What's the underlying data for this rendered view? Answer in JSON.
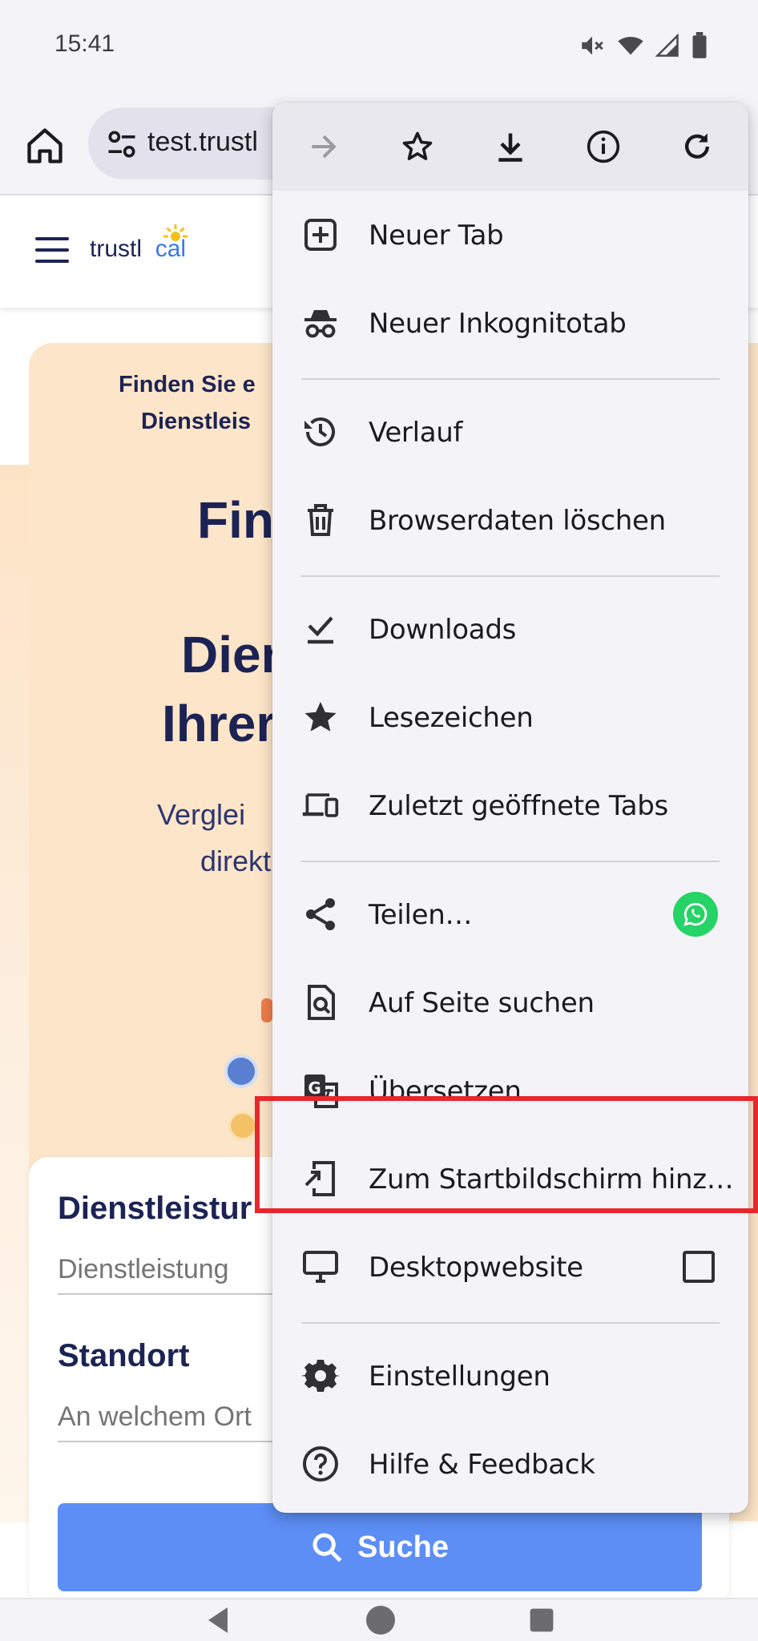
{
  "status_bar": {
    "time": "15:41"
  },
  "browser": {
    "url": "test.trustl",
    "url_full": "test.trustlocal"
  },
  "page": {
    "logo_text_a": "trustl",
    "logo_text_b": "cal",
    "hero_sub_line1": "Finden Sie e",
    "hero_sub_line2": "Dienstleis",
    "hero_h1": "Fin",
    "hero_h2": "Dien",
    "hero_h3": "Ihrer",
    "hero_p1": "Verglei",
    "hero_p2": "direkt",
    "service_label": "Dienstleistur",
    "service_placeholder": "Dienstleistung",
    "location_label": "Standort",
    "location_placeholder": "An welchem Ort",
    "search_button": "Suche"
  },
  "menu": {
    "toolbar": [
      "forward-icon",
      "star-icon",
      "download-icon",
      "info-icon",
      "reload-icon"
    ],
    "items": [
      {
        "label": "Neuer Tab",
        "icon": "new-tab-icon"
      },
      {
        "label": "Neuer Inkognitotab",
        "icon": "incognito-icon"
      },
      {
        "label": "Verlauf",
        "icon": "history-icon"
      },
      {
        "label": "Browserdaten löschen",
        "icon": "trash-icon"
      },
      {
        "label": "Downloads",
        "icon": "downloads-icon"
      },
      {
        "label": "Lesezeichen",
        "icon": "bookmarks-star-icon"
      },
      {
        "label": "Zuletzt geöffnete Tabs",
        "icon": "devices-icon"
      },
      {
        "label": "Teilen…",
        "icon": "share-icon"
      },
      {
        "label": "Auf Seite suchen",
        "icon": "find-in-page-icon"
      },
      {
        "label": "Übersetzen…",
        "icon": "translate-icon"
      },
      {
        "label": "Zum Startbildschirm hinz…",
        "icon": "add-to-home-icon"
      },
      {
        "label": "Desktopwebsite",
        "icon": "desktop-icon"
      },
      {
        "label": "Einstellungen",
        "icon": "settings-gear-icon"
      },
      {
        "label": "Hilfe & Feedback",
        "icon": "help-icon"
      }
    ],
    "desktop_site_checked": false
  },
  "colors": {
    "highlight": "#e8262c",
    "search_button": "#5c8ef5",
    "navy": "#1c2354",
    "whatsapp": "#25d366"
  }
}
